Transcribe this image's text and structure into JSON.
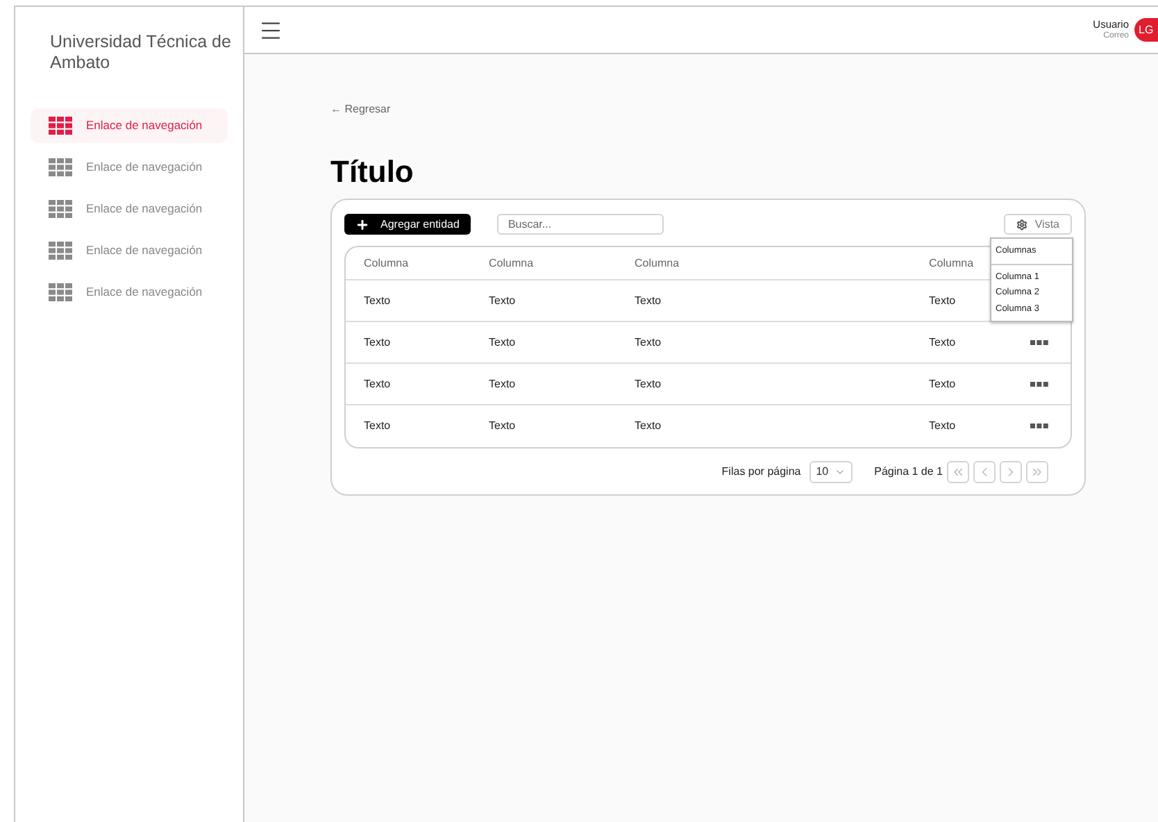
{
  "sidebar": {
    "title": "Universidad Técnica de Ambato",
    "items": [
      {
        "label": "Enlace de navegación",
        "selected": true
      },
      {
        "label": "Enlace de navegación",
        "selected": false
      },
      {
        "label": "Enlace de navegación",
        "selected": false
      },
      {
        "label": "Enlace de navegación",
        "selected": false
      },
      {
        "label": "Enlace de navegación",
        "selected": false
      }
    ]
  },
  "user": {
    "name": "Usuario",
    "email": "Correo",
    "initials": "LG"
  },
  "back_link": "← Regresar",
  "title": "Título",
  "toolbar": {
    "add_button": "Agregar entidad",
    "search": {
      "placeholder": "Buscar..."
    },
    "view_button": "Vista"
  },
  "view_menu": {
    "header": "Columnas",
    "items": [
      "Columna 1",
      "Columna 2",
      "Columna 3"
    ]
  },
  "table": {
    "columns": [
      "Columna",
      "Columna",
      "Columna",
      "Columna"
    ],
    "rows": [
      {
        "cells": [
          "Texto",
          "Texto",
          "Texto",
          "Texto"
        ]
      },
      {
        "cells": [
          "Texto",
          "Texto",
          "Texto",
          "Texto"
        ]
      },
      {
        "cells": [
          "Texto",
          "Texto",
          "Texto",
          "Texto"
        ]
      },
      {
        "cells": [
          "Texto",
          "Texto",
          "Texto",
          "Texto"
        ]
      }
    ]
  },
  "pagination": {
    "rows_label": "Filas por página",
    "rows_value": "10",
    "page_label": "Página 1 de 1"
  }
}
